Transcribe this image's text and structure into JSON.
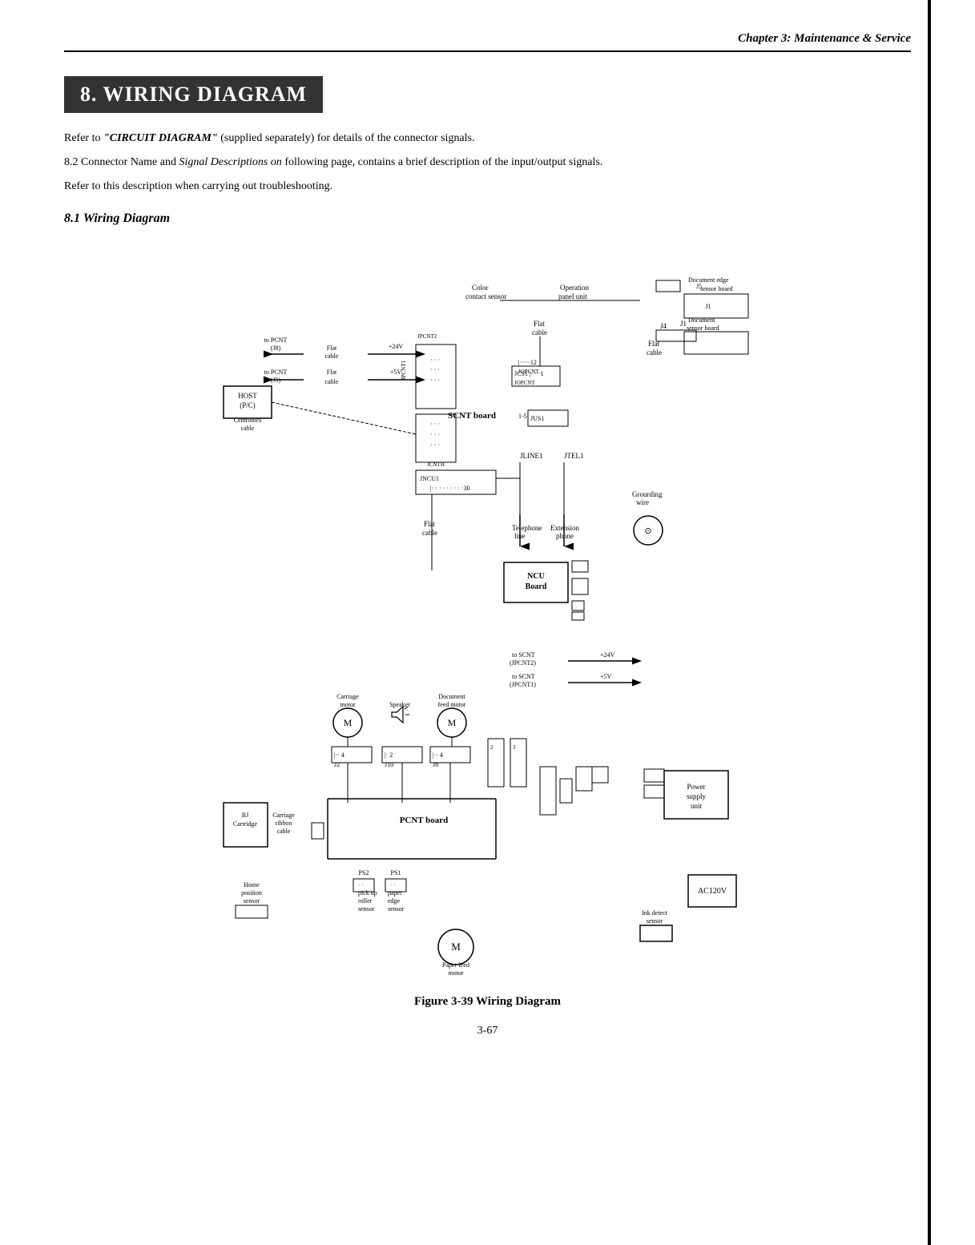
{
  "header": {
    "chapter_label": "Chapter 3: Maintenance & Service"
  },
  "section": {
    "number": "8",
    "title": "WIRING DIAGRAM",
    "subsection_title": "8.1 Wiring Diagram"
  },
  "body": {
    "line1_prefix": "Refer to ",
    "line1_quote": "\"CIRCUIT DIAGRAM\"",
    "line1_suffix": " (supplied separately) for details of the connector signals.",
    "line2": "8.2 Connector Name and ",
    "line2_italic": "Signal Descriptions on",
    "line2_suffix": " following page, contains a brief description of the input/output signals.",
    "line3": "Refer to this description when carrying out troubleshooting."
  },
  "figure_caption": "Figure  3-39  Wiring Diagram",
  "page_number": "3-67"
}
